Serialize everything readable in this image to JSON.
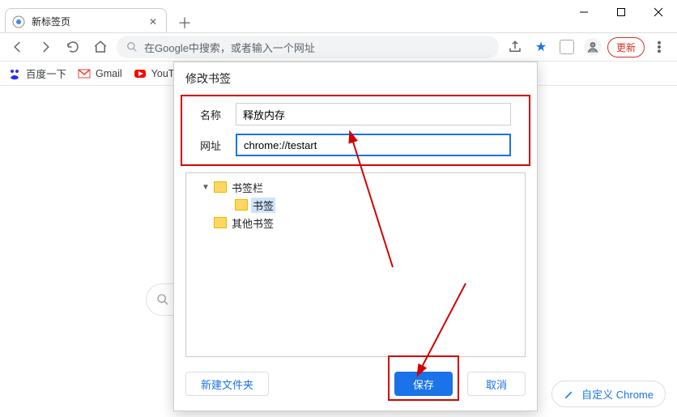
{
  "window": {
    "tab_title": "新标签页"
  },
  "toolbar": {
    "omnibox_placeholder": "在Google中搜索，或者输入一个网址",
    "update_label": "更新"
  },
  "bookmarks_bar": {
    "items": [
      {
        "label": "百度一下"
      },
      {
        "label": "Gmail"
      },
      {
        "label": "YouTu"
      }
    ]
  },
  "dialog": {
    "title": "修改书签",
    "name_label": "名称",
    "url_label": "网址",
    "name_value": "释放内存",
    "url_value": "chrome://testart",
    "tree": {
      "root": "书签栏",
      "child": "书签",
      "other": "其他书签"
    },
    "new_folder": "新建文件夹",
    "save": "保存",
    "cancel": "取消"
  },
  "customize": {
    "label": "自定义 Chrome"
  }
}
